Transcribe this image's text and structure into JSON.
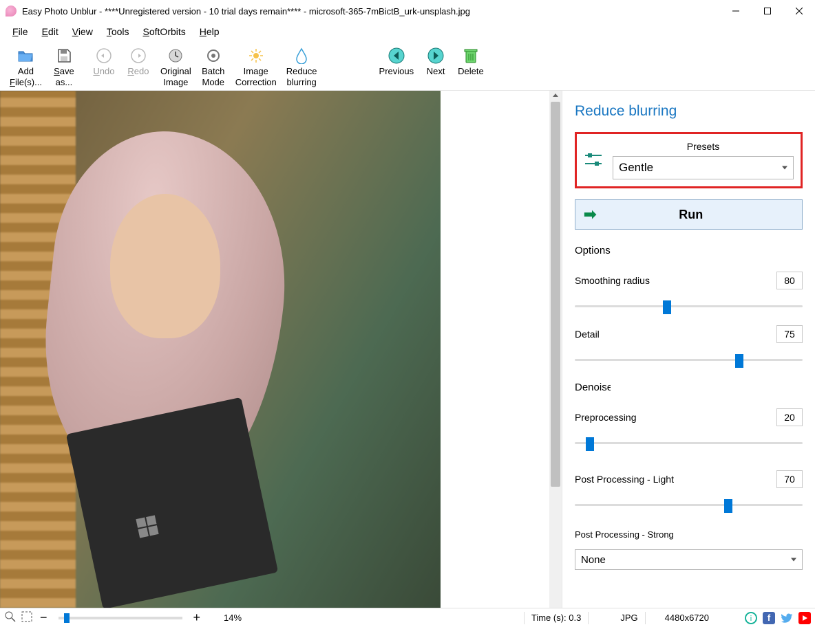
{
  "window": {
    "title": "Easy Photo Unblur - ****Unregistered version - 10 trial days remain**** - microsoft-365-7mBictB_urk-unsplash.jpg"
  },
  "menu": {
    "file": "File",
    "edit": "Edit",
    "view": "View",
    "tools": "Tools",
    "softorbits": "SoftOrbits",
    "help": "Help"
  },
  "toolbar": {
    "add_files1": "Add",
    "add_files2": "File(s)...",
    "save_as1": "Save",
    "save_as2": "as...",
    "undo": "Undo",
    "redo": "Redo",
    "original1": "Original",
    "original2": "Image",
    "batch1": "Batch",
    "batch2": "Mode",
    "image_corr1": "Image",
    "image_corr2": "Correction",
    "reduce1": "Reduce",
    "reduce2": "blurring",
    "previous": "Previous",
    "next": "Next",
    "delete": "Delete"
  },
  "panel": {
    "title": "Reduce blurring",
    "presets_label": "Presets",
    "preset_value": "Gentle",
    "run": "Run",
    "options_h": "Options",
    "smoothing_label": "Smoothing radius",
    "smoothing_val": "80",
    "smoothing_pct": 40,
    "detail_label": "Detail",
    "detail_val": "75",
    "detail_pct": 73,
    "denoise_h": "Denoise",
    "pre_label": "Preprocessing",
    "pre_val": "20",
    "pre_pct": 5,
    "postl_label": "Post Processing - Light",
    "postl_val": "70",
    "postl_pct": 68,
    "posts_label": "Post Processing - Strong",
    "posts_value": "None"
  },
  "status": {
    "zoom_pct": "14%",
    "time_label": "Time (s): 0.3",
    "format": "JPG",
    "dimensions": "4480x6720"
  }
}
